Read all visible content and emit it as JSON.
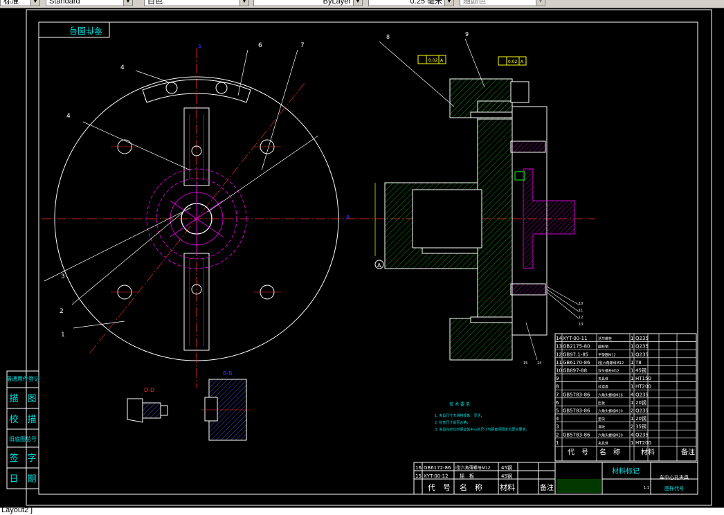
{
  "toolbar": {
    "layer_combo": "标准",
    "style_combo": "Standard",
    "color_combo": "白色",
    "linetype_combo": "ByLayer",
    "lineweight_combo": "0.25 毫米",
    "plotstyle_combo": "随颜色"
  },
  "drawing": {
    "left_title": "零件图号",
    "labels": {
      "l1": "1",
      "l2": "2",
      "l3": "3",
      "l4a": "4",
      "l4b": "4",
      "l6": "6",
      "l7": "7",
      "l8": "8",
      "l9": "9"
    },
    "section_labels": {
      "dd": "D-D",
      "bb": "B-B",
      "a1": "A",
      "a2": "A"
    },
    "tolerance": {
      "t1": "0.02",
      "t1ref": "A",
      "t2": "0.02",
      "t2ref": "A"
    },
    "callouts": [
      "10",
      "11",
      "12",
      "13",
      "14",
      "15",
      "16"
    ],
    "datum": "A"
  },
  "left_stamps": [
    "借通用件登记",
    "描　图",
    "校　描",
    "旧底图总号",
    "签　字",
    "日　期"
  ],
  "tech_req": {
    "title": "技 术 要 求",
    "items": [
      "1. 夹具尺寸无滑移现象，灵活；",
      "2. 检查尺寸是否合格；",
      "3. 夹具在定位时保证其中心的尺寸与距离间隔定位配合要求。"
    ]
  },
  "bom": {
    "rows": [
      {
        "no": "14",
        "code": "XYT-00-11",
        "name": "活节螺栓",
        "qty": "1",
        "mat": "Q235"
      },
      {
        "no": "13",
        "code": "GB2175-80",
        "name": "圆柱销",
        "qty": "1",
        "mat": "Q235"
      },
      {
        "no": "12",
        "code": "GB97.1-85",
        "name": "平垫圈M12",
        "qty": "1",
        "mat": "Q235"
      },
      {
        "no": "11",
        "code": "GB6170-86",
        "name": "I型六角螺母M12",
        "qty": "1",
        "mat": "T8"
      },
      {
        "no": "10",
        "code": "GB897-88",
        "name": "双头螺柱M12",
        "qty": "1",
        "mat": "45钢"
      },
      {
        "no": "9",
        "code": "",
        "name": "夹具体",
        "qty": "1",
        "mat": "HT150"
      },
      {
        "no": "8",
        "code": "",
        "name": "过渡盘",
        "qty": "1",
        "mat": "HT200"
      },
      {
        "no": "7",
        "code": "GB5783-86",
        "name": "六角头螺栓M16",
        "qty": "4",
        "mat": "Q235"
      },
      {
        "no": "6",
        "code": "",
        "name": "压板",
        "qty": "1",
        "mat": "20钢"
      },
      {
        "no": "5",
        "code": "GB5783-86",
        "name": "六角头螺栓M10",
        "qty": "2",
        "mat": "Q235"
      },
      {
        "no": "4",
        "code": "",
        "name": "垫块",
        "qty": "1",
        "mat": "20钢"
      },
      {
        "no": "3",
        "code": "",
        "name": "滑块",
        "qty": "2",
        "mat": "35钢"
      },
      {
        "no": "2",
        "code": "GB5783-86",
        "name": "六角头螺栓M20",
        "qty": "4",
        "mat": "Q235"
      },
      {
        "no": "1",
        "code": "",
        "name": "夹具体",
        "qty": "1",
        "mat": "HT200"
      }
    ],
    "header": {
      "no": "序号",
      "code": "代　号",
      "name": "名　称",
      "qty": "数量",
      "mat": "材料",
      "weight": "单件 总计\n重　量",
      "note": "备注"
    }
  },
  "bom2": {
    "rows": [
      {
        "no": "16",
        "code": "GB6172-86",
        "name": "I型六角薄螺母M12",
        "qty": "1",
        "mat": "45钢"
      },
      {
        "no": "15",
        "code": "XYT-00-12",
        "name": "摇　板",
        "qty": "1",
        "mat": "45钢"
      }
    ]
  },
  "title_block": {
    "material_mark": "材料标记",
    "part_name": "车中心孔夹具",
    "drawing_no": "图样代号",
    "scale": "1:1"
  },
  "status": {
    "layout_text": "Layout2 ∫"
  }
}
